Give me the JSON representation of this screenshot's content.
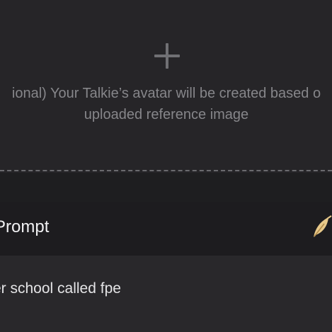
{
  "upload": {
    "icon": "plus-icon",
    "hint": "ional) Your Talkie’s avatar will be created based o\nuploaded reference image"
  },
  "prompt": {
    "title": "Prompt",
    "action_icon": "quill-icon",
    "text": "er school called fpe"
  },
  "colors": {
    "background": "#1e1e20",
    "upload_area": "#262528",
    "prompt_body": "#29282b",
    "muted_text": "#86868a",
    "accent_gold": "#e8c98a"
  }
}
